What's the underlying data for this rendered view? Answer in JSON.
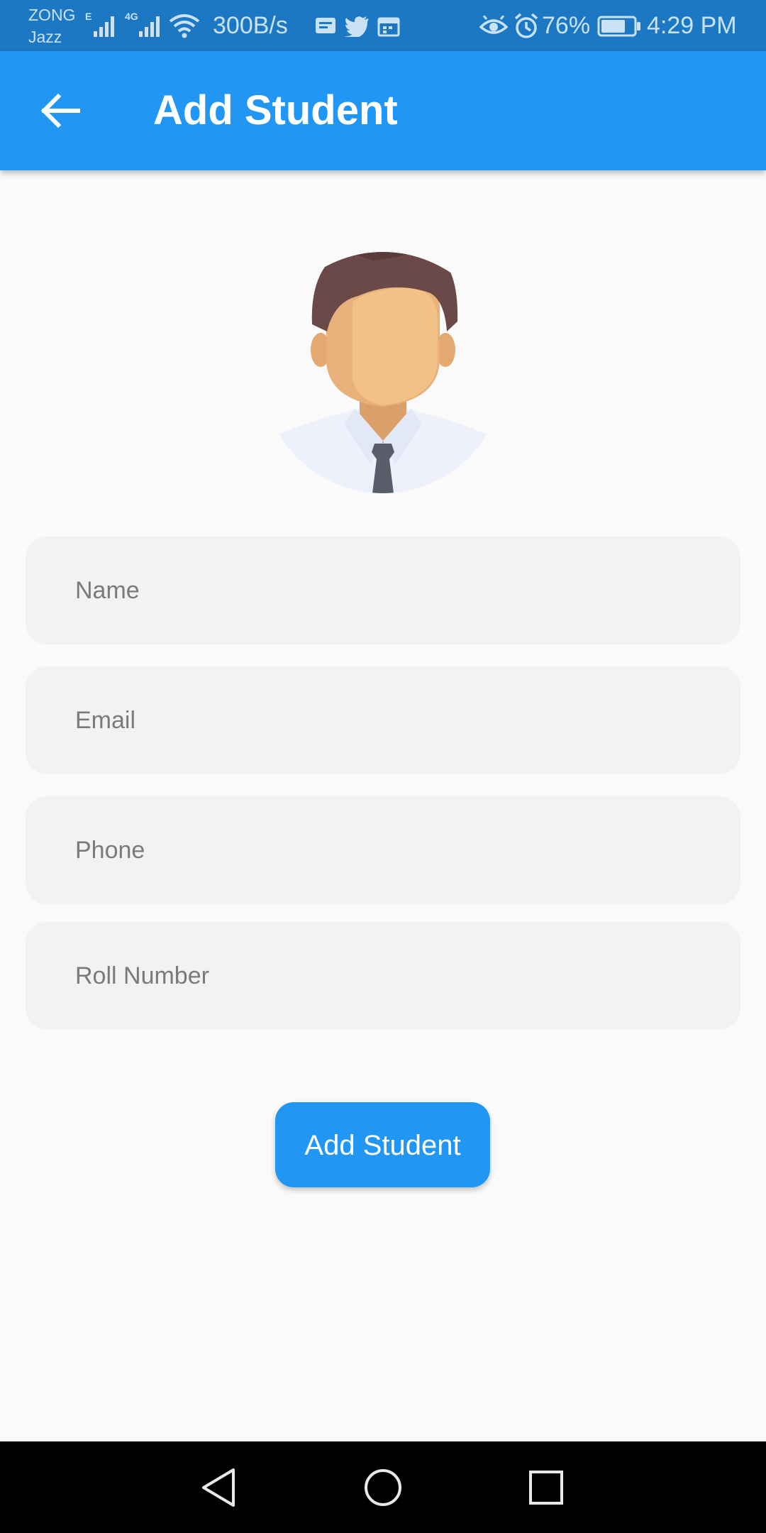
{
  "status_bar": {
    "carrier_line1": "ZONG",
    "carrier_line2": "Jazz",
    "network_speed": "300B/s",
    "battery_percent": "76%",
    "time": "4:29 PM",
    "icons": [
      "edge-signal-icon",
      "4g-signal-icon",
      "wifi-icon",
      "message-icon",
      "twitter-icon",
      "calendar-icon",
      "eye-icon",
      "alarm-icon",
      "battery-icon"
    ],
    "battery_level": 0.76
  },
  "app_bar": {
    "title": "Add Student",
    "back_icon": "arrow-back-icon"
  },
  "avatar": {
    "icon": "student-avatar-icon"
  },
  "form": {
    "name_placeholder": "Name",
    "email_placeholder": "Email",
    "phone_placeholder": "Phone",
    "roll_placeholder": "Roll Number",
    "submit_label": "Add Student"
  },
  "nav_bar": {
    "icons": [
      "back-triangle-icon",
      "home-circle-icon",
      "recents-square-icon"
    ]
  },
  "colors": {
    "status_bar": "#1c78c2",
    "app_bar": "#2196f3",
    "accent": "#2196f3",
    "field_bg": "#f2f2f2",
    "background": "#fafafa"
  }
}
